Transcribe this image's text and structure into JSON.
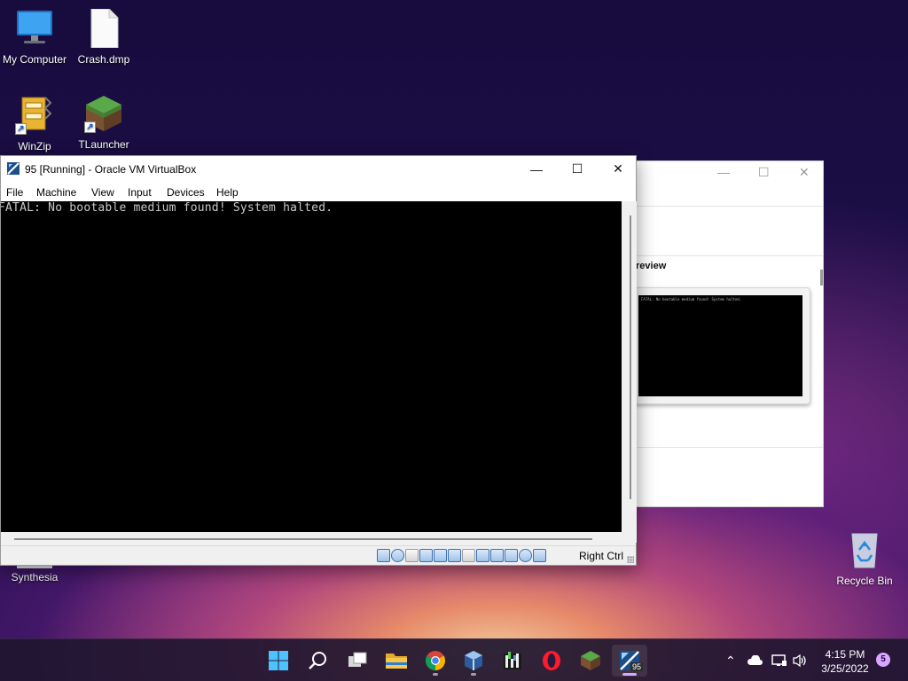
{
  "desktop": {
    "icons": [
      {
        "label": "My Computer",
        "icon": "monitor-icon"
      },
      {
        "label": "Crash.dmp",
        "icon": "file-icon"
      },
      {
        "label": "WinZip",
        "icon": "winzip-icon"
      },
      {
        "label": "TLauncher",
        "icon": "grass-block-icon"
      },
      {
        "label": "Synthesia",
        "icon": "piano-keys-icon"
      },
      {
        "label": "Recycle Bin",
        "icon": "recycle-bin-icon"
      }
    ]
  },
  "vbox": {
    "title": "95 [Running] - Oracle VM VirtualBox",
    "menu": [
      "File",
      "Machine",
      "View",
      "Input",
      "Devices",
      "Help"
    ],
    "screen_text": "FATAL: No bootable medium found! System halted.",
    "host_key": "Right Ctrl"
  },
  "bg_window": {
    "preview_label": "review",
    "preview_text": "FATAL: No bootable medium found! System halted."
  },
  "taskbar": {
    "apps": [
      "start-icon",
      "search-icon",
      "task-view-icon",
      "file-explorer-icon",
      "chrome-icon",
      "virtualbox-icon",
      "synthesia-icon",
      "opera-icon",
      "minecraft-icon",
      "virtualbox-vm-icon"
    ],
    "vm_badge": "95",
    "time": "4:15 PM",
    "date": "3/25/2022",
    "notification_count": "5"
  },
  "colors": {
    "accent": "#d9a7ff",
    "terminal_text": "#c8c8c8",
    "terminal_bg": "#000000"
  }
}
